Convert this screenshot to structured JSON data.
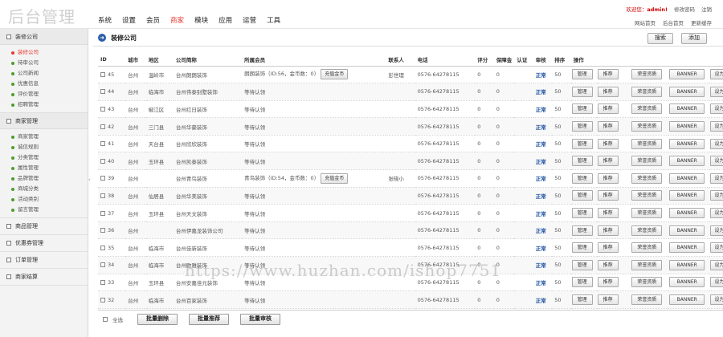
{
  "header": {
    "logo": "后台管理",
    "nav": [
      "系统",
      "设置",
      "会员",
      "商家",
      "模块",
      "应用",
      "运营",
      "工具"
    ],
    "active_nav": 3,
    "welcome": "欢迎您：",
    "user": "admin!",
    "change_password": "修改密码",
    "logout": "注销",
    "site_home": "网站首页",
    "admin_home": "后台首页",
    "update_cache": "更新缓存"
  },
  "sidebar": {
    "group1": {
      "title": "装修公司",
      "items": [
        "装修公司",
        "待审公司",
        "公司新闻",
        "优惠信息",
        "评价管理",
        "招聘管理"
      ],
      "active": 0
    },
    "group2": {
      "title": "商家管理",
      "items": [
        "商家管理",
        "诚信规则",
        "分类管理",
        "属性管理",
        "品牌管理",
        "商城分类",
        "活动类别",
        "留言管理"
      ]
    },
    "closed": [
      "商品管理",
      "优惠券管理",
      "订单管理",
      "商家结算"
    ]
  },
  "main": {
    "title": "装修公司",
    "search_btn": "搜索",
    "add_btn": "添加",
    "columns": [
      "ID",
      "城市",
      "地区",
      "公司简称",
      "所属会员",
      "联系人",
      "电话",
      "评分",
      "保障金",
      "认证",
      "审核",
      "排序",
      "操作"
    ],
    "btn_manage": "管理",
    "btn_recommend": "推荐",
    "btn_honor": "荣誉资质",
    "btn_banner": "BANNER",
    "btn_setas": "设为",
    "btn_recharge": "充值金币",
    "rows": [
      {
        "id": "45",
        "city": "台州",
        "area": "温岭市",
        "name": "台州朗朗装饰",
        "member": "朗朗装饰（ID:56，金币数：0）",
        "recharge": true,
        "contact": "彭世理",
        "phone": "0576-64278115",
        "score": "0",
        "deposit": "0",
        "status": "正常",
        "sort": "50"
      },
      {
        "id": "44",
        "city": "台州",
        "area": "临海市",
        "name": "台州伟泰别墅装饰",
        "member": "等待认领",
        "recharge": false,
        "contact": "",
        "phone": "0576-64278115",
        "score": "0",
        "deposit": "0",
        "status": "正常",
        "sort": "50"
      },
      {
        "id": "43",
        "city": "台州",
        "area": "椒江区",
        "name": "台州红日装饰",
        "member": "等待认领",
        "recharge": false,
        "contact": "",
        "phone": "0576-64278115",
        "score": "0",
        "deposit": "0",
        "status": "正常",
        "sort": "50"
      },
      {
        "id": "42",
        "city": "台州",
        "area": "三门县",
        "name": "台州华豪装饰",
        "member": "等待认领",
        "recharge": false,
        "contact": "",
        "phone": "0576-64278115",
        "score": "0",
        "deposit": "0",
        "status": "正常",
        "sort": "50"
      },
      {
        "id": "41",
        "city": "台州",
        "area": "天台县",
        "name": "台州欣欣装饰",
        "member": "等待认领",
        "recharge": false,
        "contact": "",
        "phone": "0576-64278115",
        "score": "0",
        "deposit": "0",
        "status": "正常",
        "sort": "50"
      },
      {
        "id": "40",
        "city": "台州",
        "area": "玉环县",
        "name": "台州凯泰装饰",
        "member": "等待认领",
        "recharge": false,
        "contact": "",
        "phone": "0576-64278115",
        "score": "0",
        "deposit": "0",
        "status": "正常",
        "sort": "50"
      },
      {
        "id": "39",
        "city": "台州",
        "area": "",
        "name": "台州青鸟装饰",
        "member": "青鸟装饰（ID:54，金币数：0）",
        "recharge": true,
        "contact": "张晓小",
        "phone": "0576-64278115",
        "score": "0",
        "deposit": "0",
        "status": "正常",
        "sort": "50"
      },
      {
        "id": "38",
        "city": "台州",
        "area": "仙居县",
        "name": "台州华美装饰",
        "member": "等待认领",
        "recharge": false,
        "contact": "",
        "phone": "0576-64278115",
        "score": "0",
        "deposit": "0",
        "status": "正常",
        "sort": "50"
      },
      {
        "id": "37",
        "city": "台州",
        "area": "玉环县",
        "name": "台州天文装饰",
        "member": "等待认领",
        "recharge": false,
        "contact": "",
        "phone": "0576-64278115",
        "score": "0",
        "deposit": "0",
        "status": "正常",
        "sort": "50"
      },
      {
        "id": "36",
        "city": "台州",
        "area": "",
        "name": "台州伊嘉龙装饰公司",
        "member": "等待认领",
        "recharge": false,
        "contact": "",
        "phone": "0576-64278115",
        "score": "0",
        "deposit": "0",
        "status": "正常",
        "sort": "50"
      },
      {
        "id": "35",
        "city": "台州",
        "area": "临海市",
        "name": "台州佳新装饰",
        "member": "等待认领",
        "recharge": false,
        "contact": "",
        "phone": "0576-64278115",
        "score": "0",
        "deposit": "0",
        "status": "正常",
        "sort": "50"
      },
      {
        "id": "34",
        "city": "台州",
        "area": "临海市",
        "name": "台州欧雅装饰",
        "member": "等待认领",
        "recharge": false,
        "contact": "",
        "phone": "0576-64278115",
        "score": "0",
        "deposit": "0",
        "status": "正常",
        "sort": "50"
      },
      {
        "id": "33",
        "city": "台州",
        "area": "玉环县",
        "name": "台州安嘉佳元装饰",
        "member": "等待认领",
        "recharge": false,
        "contact": "",
        "phone": "0576-64278115",
        "score": "0",
        "deposit": "0",
        "status": "正常",
        "sort": "50"
      },
      {
        "id": "32",
        "city": "台州",
        "area": "临海市",
        "name": "台州百家装饰",
        "member": "等待认领",
        "recharge": false,
        "contact": "",
        "phone": "0576-64278115",
        "score": "0",
        "deposit": "0",
        "status": "正常",
        "sort": "50"
      }
    ]
  },
  "batch": {
    "select_all": "全选",
    "delete": "批量删除",
    "recommend": "批量推荐",
    "review": "批量审核"
  },
  "watermark": "https://www.huzhan.com/ishop7751"
}
